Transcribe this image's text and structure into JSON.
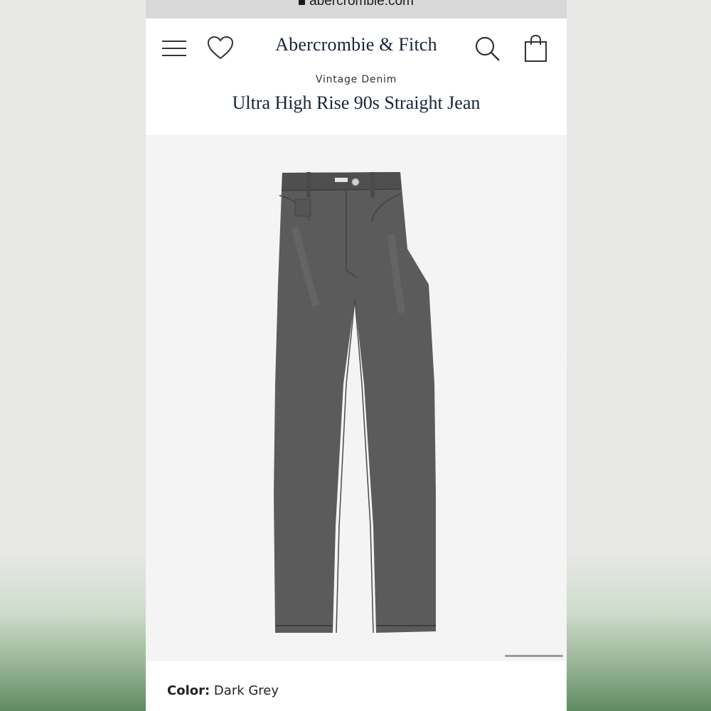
{
  "browser": {
    "url": "abercrombie.com"
  },
  "header": {
    "brand": "Abercrombie & Fitch",
    "icons": [
      "menu-icon",
      "heart-icon",
      "search-icon",
      "shopping-bag-icon"
    ]
  },
  "product": {
    "category": "Vintage Denim",
    "title": "Ultra High Rise 90s Straight Jean",
    "image_alt": "dark grey straight leg jeans",
    "color_label": "Color:",
    "color_value": "Dark Grey"
  },
  "colors": {
    "brand_navy": "#17243b",
    "denim": "#5a5a5a",
    "page_bg": "#ffffff"
  }
}
